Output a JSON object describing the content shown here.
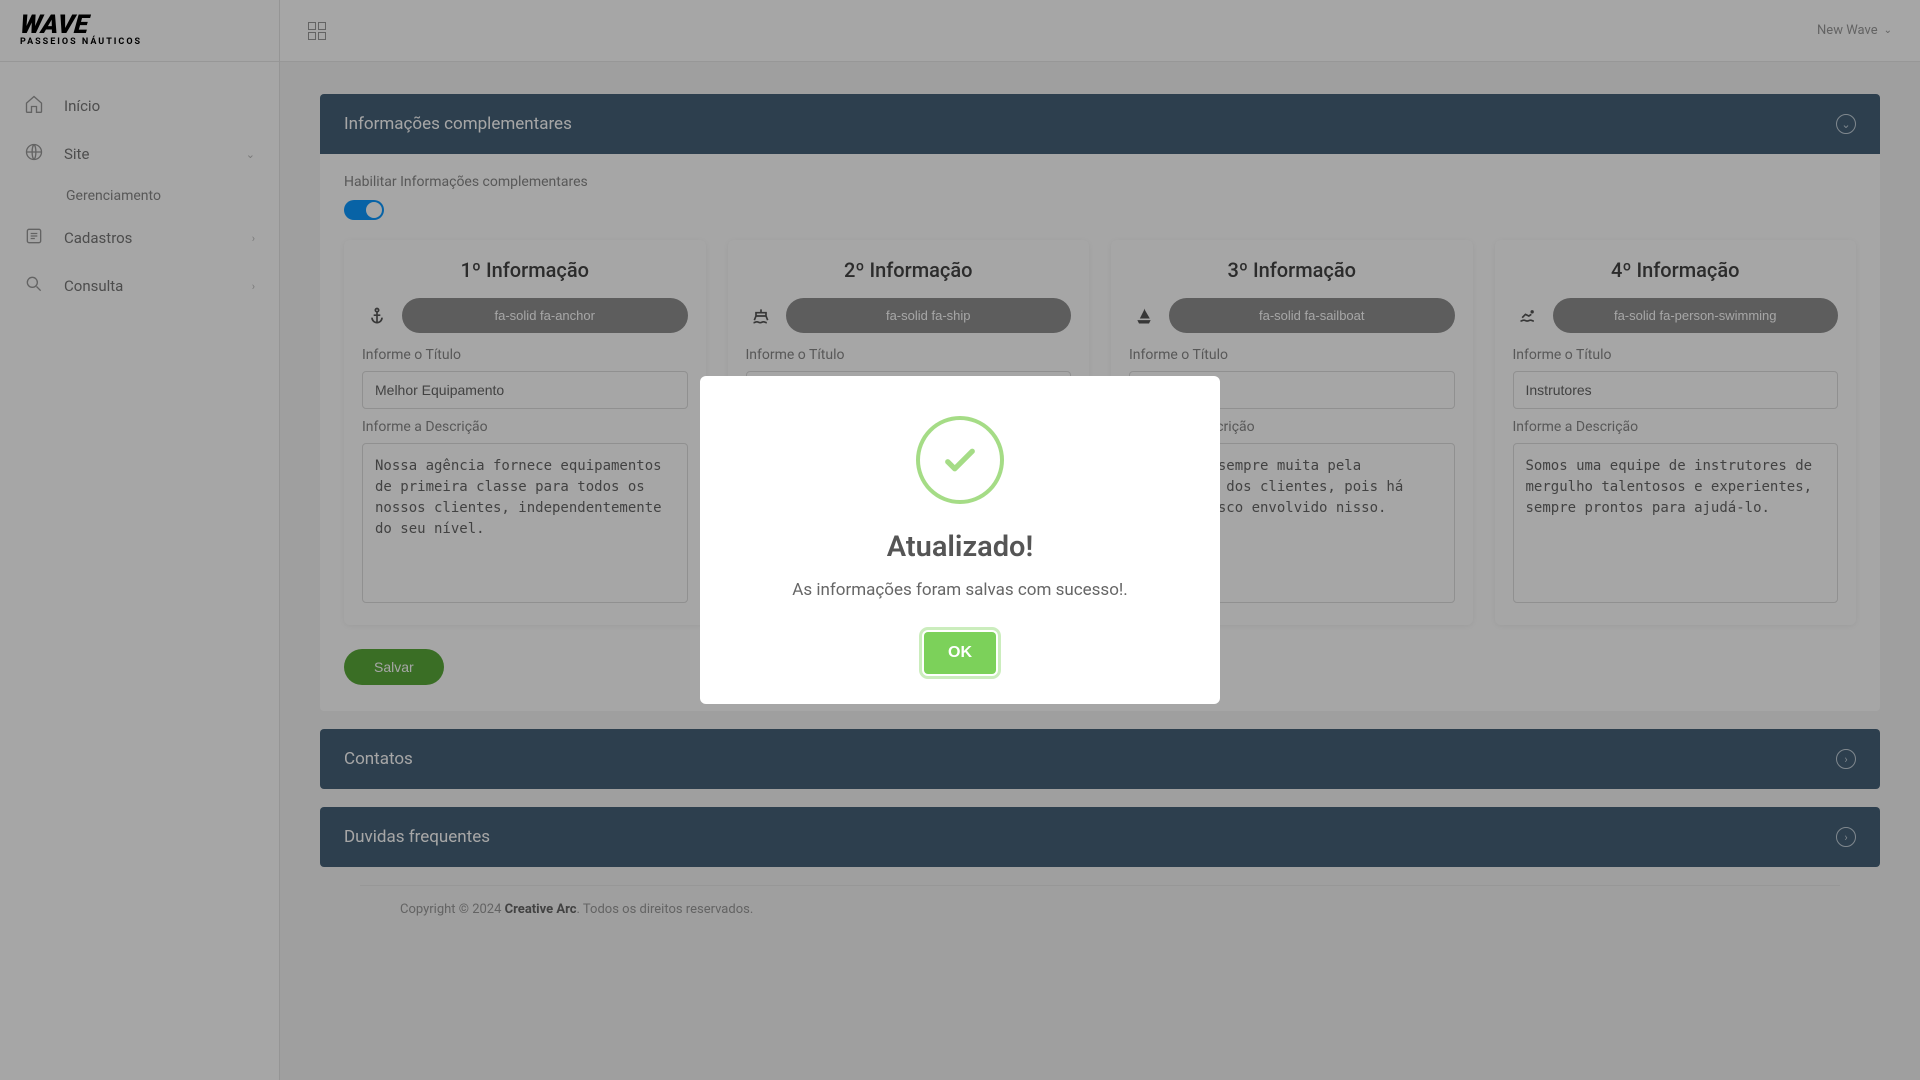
{
  "logo_text": "WAVE",
  "logo_sub": "PASSEIOS NÁUTICOS",
  "sidebar": {
    "items": [
      {
        "label": "Início",
        "icon": "home"
      },
      {
        "label": "Site",
        "icon": "globe",
        "children": [
          {
            "label": "Gerenciamento"
          }
        ]
      },
      {
        "label": "Cadastros",
        "icon": "list"
      },
      {
        "label": "Consulta",
        "icon": "search"
      }
    ]
  },
  "user_menu": {
    "name": "New Wave"
  },
  "panels": {
    "info": {
      "title": "Informações complementares",
      "enable_label": "Habilitar Informações complementares",
      "save_label": "Salvar",
      "title_field_label": "Informe o Título",
      "desc_field_label": "Informe a Descrição",
      "cards": [
        {
          "heading": "1º Informação",
          "icon_class": "fa-solid fa-anchor",
          "titulo": "Melhor Equipamento",
          "descricao": "Nossa agência fornece equipamentos de primeira classe para todos os nossos clientes, independentemente do seu nível."
        },
        {
          "heading": "2º Informação",
          "icon_class": "fa-solid fa-ship",
          "titulo": "",
          "descricao": ""
        },
        {
          "heading": "3º Informação",
          "icon_class": "fa-solid fa-sailboat",
          "titulo": "",
          "descricao": "Prezamos sempre muita pela segurança dos clientes, pois há sempre risco envolvido nisso."
        },
        {
          "heading": "4º Informação",
          "icon_class": "fa-solid fa-person-swimming",
          "titulo": "Instrutores",
          "descricao": "Somos uma equipe de instrutores de mergulho talentosos e experientes, sempre prontos para ajudá-lo."
        }
      ]
    },
    "contatos": {
      "title": "Contatos"
    },
    "duvidas": {
      "title": "Duvidas frequentes"
    }
  },
  "modal": {
    "title": "Atualizado!",
    "message": "As informações foram salvas com sucesso!.",
    "ok_label": "OK"
  },
  "footer": {
    "prefix": "Copyright © 2024 ",
    "brand": "Creative Arc",
    "suffix": ". Todos os direitos reservados."
  }
}
